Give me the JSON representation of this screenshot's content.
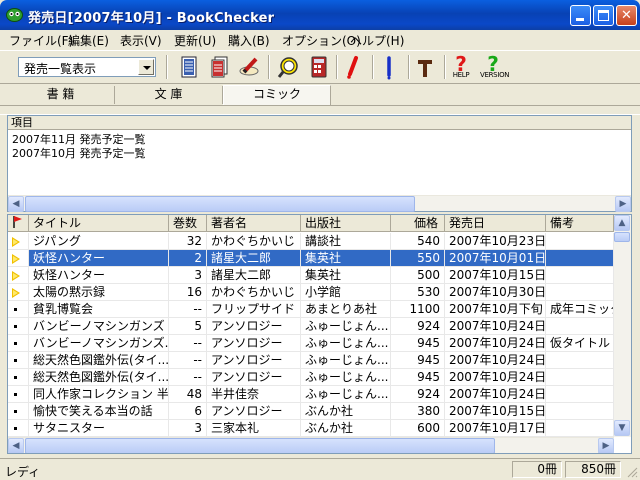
{
  "window": {
    "title": "発売日[2007年10月] - BookChecker",
    "accent": "#316AC5",
    "titlebar_color": "#0842B4"
  },
  "menu": [
    {
      "label": "ファイル(F)"
    },
    {
      "label": "編集(E)"
    },
    {
      "label": "表示(V)"
    },
    {
      "label": "更新(U)"
    },
    {
      "label": "購入(B)"
    },
    {
      "label": "オプション(O)"
    },
    {
      "label": "ヘルプ(H)"
    }
  ],
  "toolbar": {
    "view_select": "発売一覧表示",
    "tools": [
      {
        "icon": "book-list-icon"
      },
      {
        "icon": "books-stack-icon"
      },
      {
        "icon": "edit-pen-icon"
      },
      {
        "icon": "search-magnifier-icon"
      },
      {
        "icon": "calculator-icon"
      },
      {
        "icon": "red-mark-icon"
      },
      {
        "icon": "blue-mark-icon"
      },
      {
        "icon": "pin-icon"
      },
      {
        "icon": "help-icon",
        "label": "HELP"
      },
      {
        "icon": "version-icon",
        "label": "VERSION"
      }
    ]
  },
  "tabs": [
    {
      "label": "書 籍",
      "active": false
    },
    {
      "label": "文 庫",
      "active": false
    },
    {
      "label": "コミック",
      "active": true
    }
  ],
  "upper_list": {
    "header": "項目",
    "items": [
      "2007年11月 発売予定一覧",
      "2007年10月 発売予定一覧"
    ]
  },
  "table": {
    "columns": [
      "タイトル",
      "巻数",
      "著者名",
      "出版社",
      "価格",
      "発売日",
      "備考"
    ],
    "rows": [
      {
        "mark": "triangle",
        "title": "ジパング",
        "vol": "32",
        "author": "かわぐちかいじ",
        "publisher": "講談社",
        "price": "540",
        "date": "2007年10月23日",
        "note": "",
        "selected": false
      },
      {
        "mark": "triangle",
        "title": "妖怪ハンター",
        "vol": "2",
        "author": "諸星大二郎",
        "publisher": "集英社",
        "price": "550",
        "date": "2007年10月01日",
        "note": "",
        "selected": true
      },
      {
        "mark": "triangle",
        "title": "妖怪ハンター",
        "vol": "3",
        "author": "諸星大二郎",
        "publisher": "集英社",
        "price": "500",
        "date": "2007年10月15日",
        "note": "",
        "selected": false
      },
      {
        "mark": "triangle",
        "title": "太陽の黙示録",
        "vol": "16",
        "author": "かわぐちかいじ",
        "publisher": "小学館",
        "price": "530",
        "date": "2007年10月30日",
        "note": "",
        "selected": false
      },
      {
        "mark": "dot",
        "title": "貧乳博覧会",
        "vol": "--",
        "author": "フリップサイド",
        "publisher": "あまとりあ社",
        "price": "1100",
        "date": "2007年10月下旬",
        "note": "成年コミック",
        "selected": false
      },
      {
        "mark": "dot",
        "title": "バンビーノマシンガンズ",
        "vol": "5",
        "author": "アンソロジー",
        "publisher": "ふゅーじょん...",
        "price": "924",
        "date": "2007年10月24日",
        "note": "",
        "selected": false
      },
      {
        "mark": "dot",
        "title": "バンビーノマシンガンズ...",
        "vol": "--",
        "author": "アンソロジー",
        "publisher": "ふゅーじょん...",
        "price": "945",
        "date": "2007年10月24日",
        "note": "仮タイトル",
        "selected": false
      },
      {
        "mark": "dot",
        "title": "総天然色図鑑外伝(タイ...",
        "vol": "--",
        "author": "アンソロジー",
        "publisher": "ふゅーじょん...",
        "price": "945",
        "date": "2007年10月24日",
        "note": "",
        "selected": false
      },
      {
        "mark": "dot",
        "title": "総天然色図鑑外伝(タイ...",
        "vol": "--",
        "author": "アンソロジー",
        "publisher": "ふゅーじょん...",
        "price": "945",
        "date": "2007年10月24日",
        "note": "",
        "selected": false
      },
      {
        "mark": "dot",
        "title": "同人作家コレクション 半...",
        "vol": "48",
        "author": "半井佳奈",
        "publisher": "ふゅーじょん...",
        "price": "924",
        "date": "2007年10月24日",
        "note": "",
        "selected": false
      },
      {
        "mark": "dot",
        "title": "愉快で笑える本当の話",
        "vol": "6",
        "author": "アンソロジー",
        "publisher": "ぶんか社",
        "price": "380",
        "date": "2007年10月15日",
        "note": "",
        "selected": false
      },
      {
        "mark": "dot",
        "title": "サタニスター",
        "vol": "3",
        "author": "三家本礼",
        "publisher": "ぶんか社",
        "price": "600",
        "date": "2007年10月17日",
        "note": "",
        "selected": false
      }
    ]
  },
  "status": {
    "message": "レディ",
    "count_a": "0冊",
    "count_b": "850冊"
  }
}
